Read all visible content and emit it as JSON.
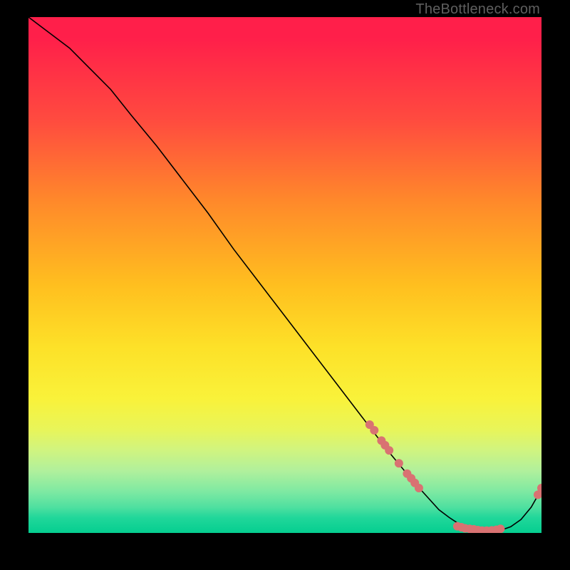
{
  "watermark": "TheBottleneck.com",
  "chart_data": {
    "type": "line",
    "title": "",
    "xlabel": "",
    "ylabel": "",
    "xlim": [
      0,
      100
    ],
    "ylim": [
      0,
      100
    ],
    "grid": false,
    "series": [
      {
        "name": "bottleneck-curve",
        "color": "#000000",
        "x": [
          0,
          4,
          8,
          12,
          16,
          20,
          25,
          30,
          35,
          40,
          45,
          50,
          55,
          60,
          65,
          70,
          75,
          80,
          82,
          84,
          86,
          88,
          90,
          92,
          94,
          96,
          98,
          100
        ],
        "y": [
          100,
          97,
          94,
          90,
          86,
          81,
          75,
          68.5,
          62,
          55,
          48.5,
          42,
          35.5,
          29,
          22.5,
          16,
          10,
          4.5,
          3,
          1.7,
          1,
          0.5,
          0.3,
          0.5,
          1.2,
          2.6,
          5,
          8.5
        ]
      }
    ],
    "markers": [
      {
        "name": "marker-cluster",
        "color": "#d97272",
        "radius_px": 6,
        "points": [
          {
            "x": 66.5,
            "y": 21
          },
          {
            "x": 67.4,
            "y": 19.9
          },
          {
            "x": 68.8,
            "y": 17.9
          },
          {
            "x": 69.5,
            "y": 17
          },
          {
            "x": 70.3,
            "y": 16
          },
          {
            "x": 72.2,
            "y": 13.5
          },
          {
            "x": 73.8,
            "y": 11.5
          },
          {
            "x": 74.6,
            "y": 10.6
          },
          {
            "x": 75.3,
            "y": 9.7
          },
          {
            "x": 76.1,
            "y": 8.7
          },
          {
            "x": 83.6,
            "y": 1.3
          },
          {
            "x": 84.4,
            "y": 1.1
          },
          {
            "x": 85.1,
            "y": 0.9
          },
          {
            "x": 86.0,
            "y": 0.8
          },
          {
            "x": 86.8,
            "y": 0.7
          },
          {
            "x": 87.6,
            "y": 0.55
          },
          {
            "x": 88.4,
            "y": 0.45
          },
          {
            "x": 89.3,
            "y": 0.45
          },
          {
            "x": 90.3,
            "y": 0.5
          },
          {
            "x": 91.2,
            "y": 0.6
          },
          {
            "x": 92.0,
            "y": 0.8
          },
          {
            "x": 99.3,
            "y": 7.4
          },
          {
            "x": 100,
            "y": 8.7
          }
        ]
      }
    ]
  }
}
